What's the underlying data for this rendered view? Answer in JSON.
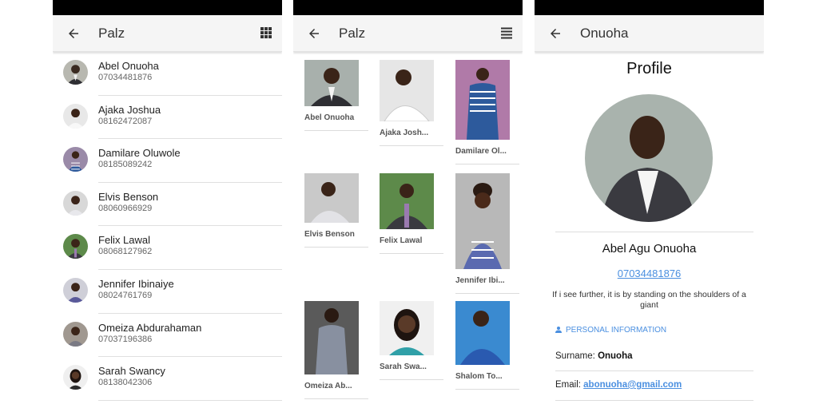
{
  "list_screen": {
    "title": "Palz",
    "back_icon": "arrow-back-icon",
    "action_icon": "grid-view-icon",
    "contacts": [
      {
        "name": "Abel Onuoha",
        "phone": "07034481876"
      },
      {
        "name": "Ajaka Joshua",
        "phone": "08162472087"
      },
      {
        "name": "Damilare Oluwole",
        "phone": "08185089242"
      },
      {
        "name": "Elvis Benson",
        "phone": "08060966929"
      },
      {
        "name": "Felix Lawal",
        "phone": "08068127962"
      },
      {
        "name": "Jennifer Ibinaiye",
        "phone": "08024761769"
      },
      {
        "name": "Omeiza Abdurahaman",
        "phone": "07037196386"
      },
      {
        "name": "Sarah Swancy",
        "phone": "08138042306"
      }
    ]
  },
  "grid_screen": {
    "title": "Palz",
    "back_icon": "arrow-back-icon",
    "action_icon": "list-view-icon",
    "cells": [
      {
        "label": "Abel Onuoha"
      },
      {
        "label": "Ajaka Josh..."
      },
      {
        "label": "Damilare Ol..."
      },
      {
        "label": "Elvis Benson"
      },
      {
        "label": "Felix Lawal"
      },
      {
        "label": "Jennifer Ibi..."
      },
      {
        "label": "Omeiza Ab..."
      },
      {
        "label": "Sarah Swa..."
      },
      {
        "label": "Shalom To..."
      }
    ]
  },
  "profile_screen": {
    "title": "Onuoha",
    "back_icon": "arrow-back-icon",
    "heading": "Profile",
    "full_name": "Abel Agu Onuoha",
    "phone": "07034481876",
    "quote": "If i see further, it is by standing on the shoulders of a giant",
    "section_label": "PERSONAL INFORMATION",
    "surname_label": "Surname:",
    "surname_value": "Onuoha",
    "email_label": "Email:",
    "email_value": "abonuoha@gmail.com"
  },
  "colors": {
    "accent": "#4a8fe0",
    "appbar": "#f5f5f5",
    "statusbar": "#000000"
  }
}
